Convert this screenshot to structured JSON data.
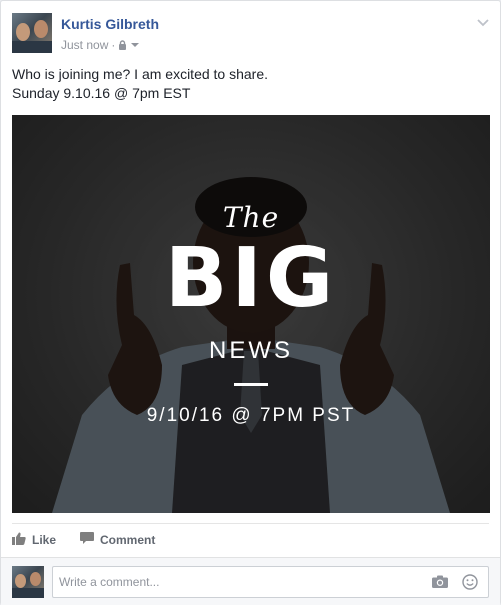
{
  "post": {
    "author": "Kurtis Gilbreth",
    "timestamp": "Just now",
    "separator": "·",
    "privacy_icon": "lock-icon",
    "message_line1": "Who is joining me? I am excited to share.",
    "message_line2": "Sunday 9.10.16 @ 7pm EST"
  },
  "image": {
    "word_the": "The",
    "word_big": "BIG",
    "word_news": "NEWS",
    "date_text": "9/10/16 @ 7PM PST"
  },
  "actions": {
    "like_label": "Like",
    "comment_label": "Comment"
  },
  "comment": {
    "placeholder": "Write a comment...",
    "value": ""
  },
  "colors": {
    "author_link": "#365899",
    "meta_gray": "#90949c",
    "action_gray": "#616770"
  }
}
